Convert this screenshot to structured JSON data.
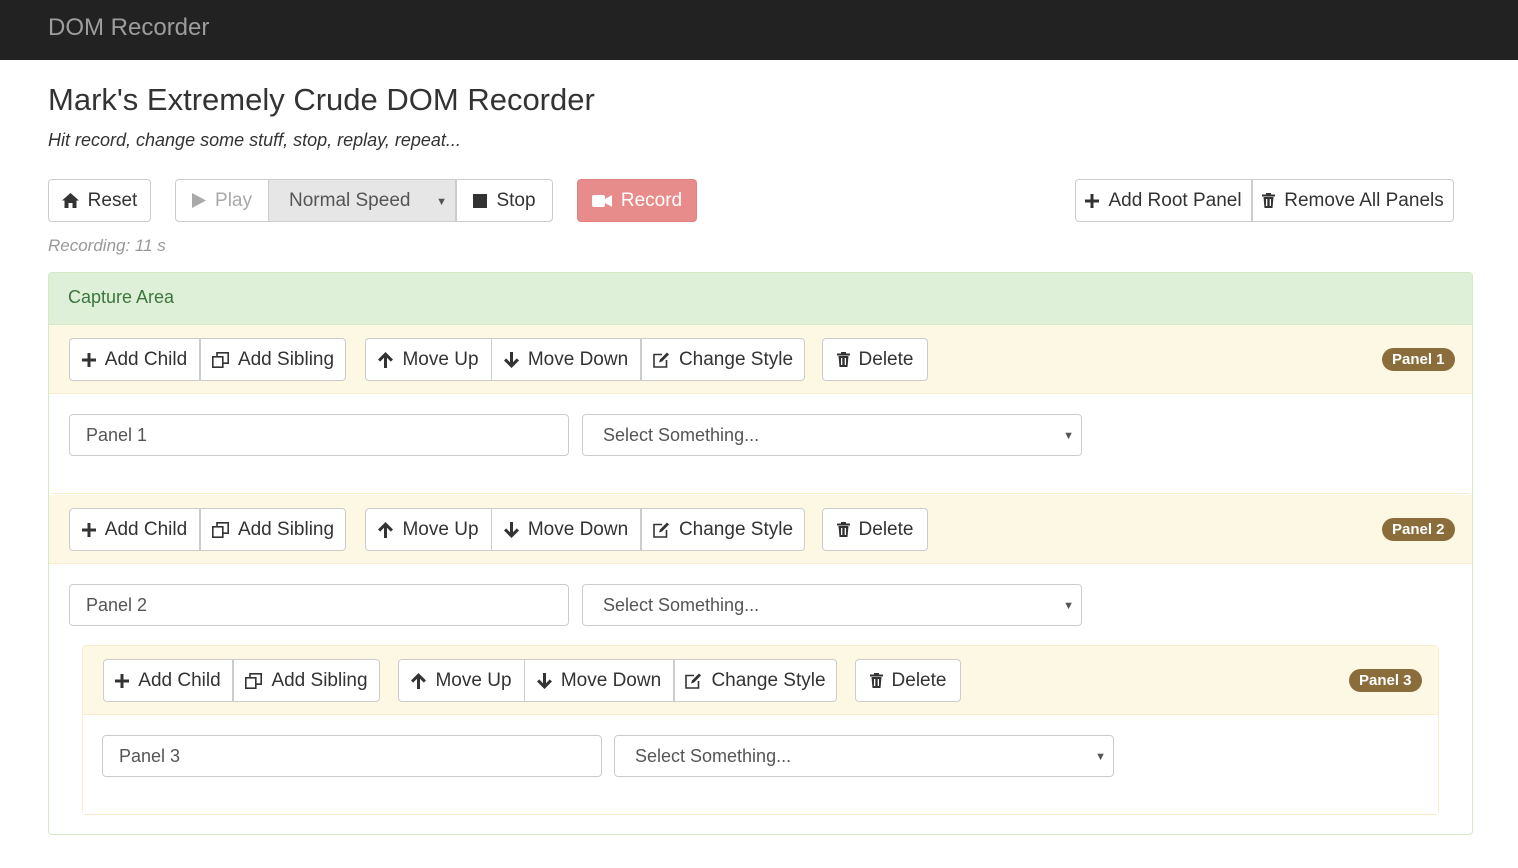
{
  "navbar": {
    "brand": "DOM Recorder"
  },
  "header": {
    "title": "Mark's Extremely Crude DOM Recorder",
    "subtitle": "Hit record, change some stuff, stop, replay, repeat..."
  },
  "toolbar": {
    "reset_label": "Reset",
    "play_label": "Play",
    "speed_value": "Normal Speed",
    "stop_label": "Stop",
    "record_label": "Record",
    "add_root_label": "Add Root Panel",
    "remove_all_label": "Remove All Panels"
  },
  "status": {
    "recording_text": "Recording: 11 s"
  },
  "capture": {
    "title": "Capture Area"
  },
  "panel_actions": {
    "add_child": "Add Child",
    "add_sibling": "Add Sibling",
    "move_up": "Move Up",
    "move_down": "Move Down",
    "change_style": "Change Style",
    "delete": "Delete"
  },
  "panels": [
    {
      "badge": "Panel 1",
      "input_value": "Panel 1",
      "select_value": "Select Something..."
    },
    {
      "badge": "Panel 2",
      "input_value": "Panel 2",
      "select_value": "Select Something..."
    },
    {
      "badge": "Panel 3",
      "input_value": "Panel 3",
      "select_value": "Select Something..."
    }
  ],
  "colors": {
    "navbar_bg": "#222222",
    "record_button": "#e78b8b",
    "capture_header_bg": "#dff0d8",
    "panel_header_bg": "#fcf8e3",
    "badge_bg": "#8a6d3b"
  }
}
